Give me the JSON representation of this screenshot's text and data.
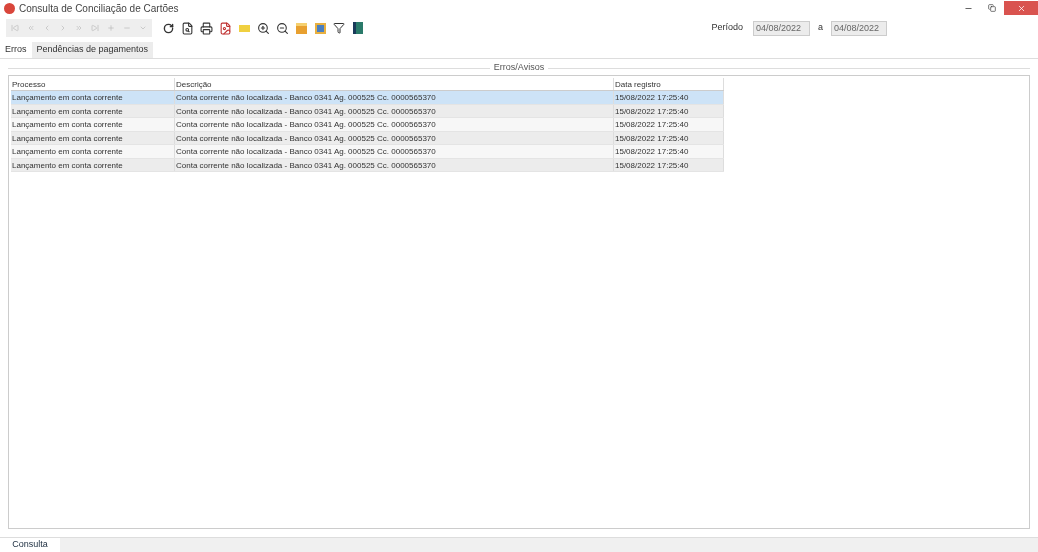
{
  "window": {
    "title": "Consulta de Conciliação de Cartões"
  },
  "period": {
    "label": "Período",
    "from": "04/08/2022",
    "separator": "a",
    "to": "04/08/2022"
  },
  "tabs": [
    {
      "label": "Erros",
      "selected": true
    },
    {
      "label": "Pendências de pagamentos",
      "selected": false
    }
  ],
  "group": {
    "title": "Erros/Avisos"
  },
  "table": {
    "columns": [
      "Processo",
      "Descrição",
      "Data registro"
    ],
    "rows": [
      {
        "cells": [
          "Lançamento em conta corrente",
          "Conta corrente não localizada - Banco 0341 Ag. 000525 Cc. 0000565370",
          "15/08/2022 17:25:40"
        ],
        "selected": true
      },
      {
        "cells": [
          "Lançamento em conta corrente",
          "Conta corrente não localizada - Banco 0341 Ag. 000525 Cc. 0000565370",
          "15/08/2022 17:25:40"
        ],
        "selected": false
      },
      {
        "cells": [
          "Lançamento em conta corrente",
          "Conta corrente não localizada - Banco 0341 Ag. 000525 Cc. 0000565370",
          "15/08/2022 17:25:40"
        ],
        "selected": false
      },
      {
        "cells": [
          "Lançamento em conta corrente",
          "Conta corrente não localizada - Banco 0341 Ag. 000525 Cc. 0000565370",
          "15/08/2022 17:25:40"
        ],
        "selected": false
      },
      {
        "cells": [
          "Lançamento em conta corrente",
          "Conta corrente não localizada - Banco 0341 Ag. 000525 Cc. 0000565370",
          "15/08/2022 17:25:40"
        ],
        "selected": false
      },
      {
        "cells": [
          "Lançamento em conta corrente",
          "Conta corrente não localizada - Banco 0341 Ag. 000525 Cc. 0000565370",
          "15/08/2022 17:25:40"
        ],
        "selected": false
      }
    ]
  },
  "bottom_tabs": [
    {
      "label": "Consulta",
      "selected": true
    }
  ]
}
